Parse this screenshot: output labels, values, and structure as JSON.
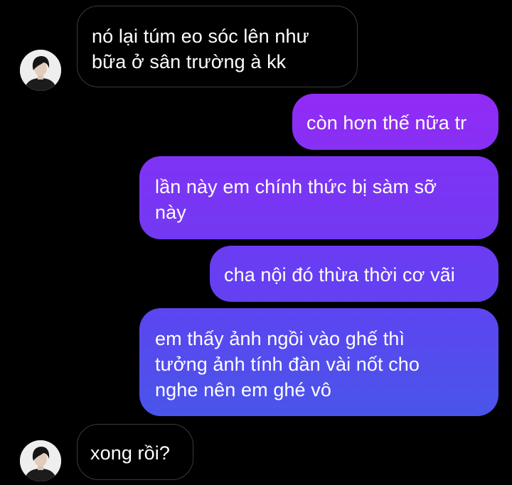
{
  "conversation": {
    "messages": [
      {
        "direction": "incoming",
        "lines": [
          "nó lại túm eo sóc lên như",
          "bữa ở sân trường à kk"
        ]
      },
      {
        "direction": "outgoing",
        "lines": [
          "còn hơn thế nữa tr"
        ],
        "color": "#8a2ff2"
      },
      {
        "direction": "outgoing",
        "lines": [
          "lần này em chính thức bị sàm sỡ",
          "này"
        ],
        "color": "#7a36f3"
      },
      {
        "direction": "outgoing",
        "lines": [
          "cha nội đó thừa thời cơ vãi"
        ],
        "color": "#6a3ef2"
      },
      {
        "direction": "outgoing",
        "lines": [
          "em thấy ảnh ngồi vào ghế thì",
          "tưởng ảnh tính đàn vài nốt cho",
          "nghe nên em ghé vô"
        ],
        "color": "#5a48ee"
      },
      {
        "direction": "incoming",
        "lines": [
          "xong rồi?"
        ]
      }
    ],
    "avatar_icon": "contact-avatar-icon",
    "colors": {
      "background": "#000000",
      "incoming_border": "#3a3a3c",
      "text": "#ffffff",
      "outgoing_gradient_top": "#8f2cf5",
      "outgoing_gradient_bottom": "#4a55ea"
    }
  }
}
